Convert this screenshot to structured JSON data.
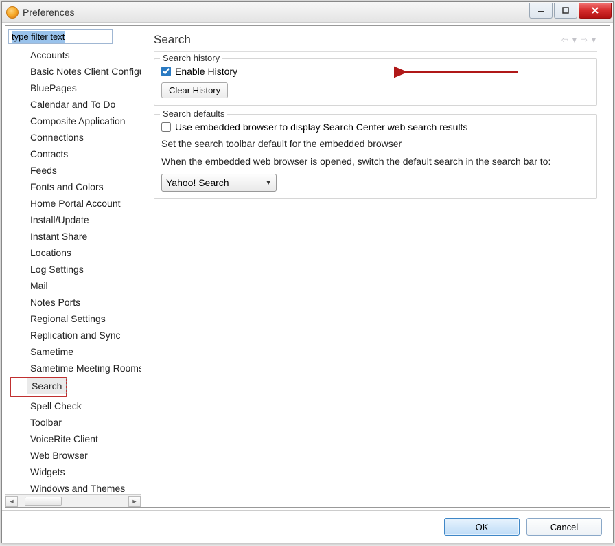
{
  "window": {
    "title": "Preferences"
  },
  "sidebar": {
    "filter_placeholder": "type filter text",
    "items": [
      "Accounts",
      "Basic Notes Client Configuration",
      "BluePages",
      "Calendar and To Do",
      "Composite Application",
      "Connections",
      "Contacts",
      "Feeds",
      "Fonts and Colors",
      "Home Portal Account",
      "Install/Update",
      "Instant Share",
      "Locations",
      "Log Settings",
      "Mail",
      "Notes Ports",
      "Regional Settings",
      "Replication and Sync",
      "Sametime",
      "Sametime Meeting Rooms",
      "Search",
      "Spell Check",
      "Toolbar",
      "VoiceRite Client",
      "Web Browser",
      "Widgets",
      "Windows and Themes"
    ],
    "selected_index": 20
  },
  "main": {
    "title": "Search",
    "history": {
      "group_title": "Search history",
      "enable_label": "Enable History",
      "enable_checked": true,
      "clear_button": "Clear History"
    },
    "defaults": {
      "group_title": "Search defaults",
      "embedded_label": "Use embedded browser to display Search Center web search results",
      "embedded_checked": false,
      "toolbar_text": "Set the search toolbar default for the embedded browser",
      "switch_text": "When the embedded web browser is opened, switch the default search in the search bar to:",
      "dropdown_value": "Yahoo! Search"
    }
  },
  "footer": {
    "ok": "OK",
    "cancel": "Cancel"
  }
}
